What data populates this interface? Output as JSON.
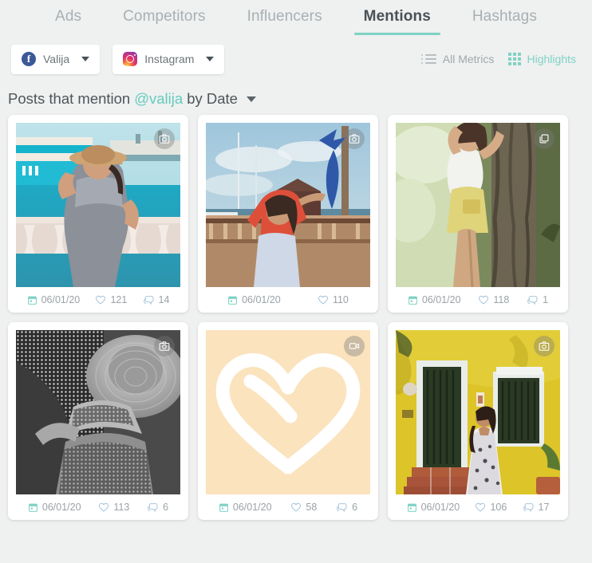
{
  "tabs": [
    {
      "label": "Ads",
      "active": false
    },
    {
      "label": "Competitors",
      "active": false
    },
    {
      "label": "Influencers",
      "active": false
    },
    {
      "label": "Mentions",
      "active": true
    },
    {
      "label": "Hashtags",
      "active": false
    }
  ],
  "filters": {
    "account": {
      "label": "Valija",
      "icon": "facebook-icon"
    },
    "network": {
      "label": "Instagram",
      "icon": "instagram-icon"
    }
  },
  "metrics": {
    "all": {
      "label": "All Metrics",
      "icon": "list-icon",
      "active": false
    },
    "highlights": {
      "label": "Highlights",
      "icon": "grid-icon",
      "active": true
    }
  },
  "title": {
    "prefix": "Posts that mention",
    "handle": "@valija",
    "suffix": "by Date"
  },
  "colors": {
    "accent": "#7fd2c4",
    "handle": "#63cdbd",
    "background": "#eff0f0",
    "card": "#ffffff",
    "muted": "#9aa2a6"
  },
  "posts": [
    {
      "alt": "Woman in patterned jumpsuit and straw hat by turquoise waterfront",
      "media_type": "photo",
      "date": "06/01/20",
      "likes": "121",
      "comments": "14"
    },
    {
      "alt": "Woman in red top on marina dock beside blue marlin statue",
      "media_type": "photo",
      "date": "06/01/20",
      "likes": "110",
      "comments": null
    },
    {
      "alt": "Woman in white crop top and yellow skirt beside a tree",
      "media_type": "carousel",
      "date": "06/01/20",
      "likes": "118",
      "comments": "1"
    },
    {
      "alt": "Black and white photo of woman in patterned swimsuit and hat",
      "media_type": "photo",
      "date": "06/01/20",
      "likes": "113",
      "comments": "6"
    },
    {
      "alt": "White outlined heart logo on cream background",
      "media_type": "video",
      "date": "06/01/20",
      "likes": "58",
      "comments": "6"
    },
    {
      "alt": "Woman in floral dress before yellow wall with green doors",
      "media_type": "photo",
      "date": "06/01/20",
      "likes": "106",
      "comments": "17"
    }
  ]
}
